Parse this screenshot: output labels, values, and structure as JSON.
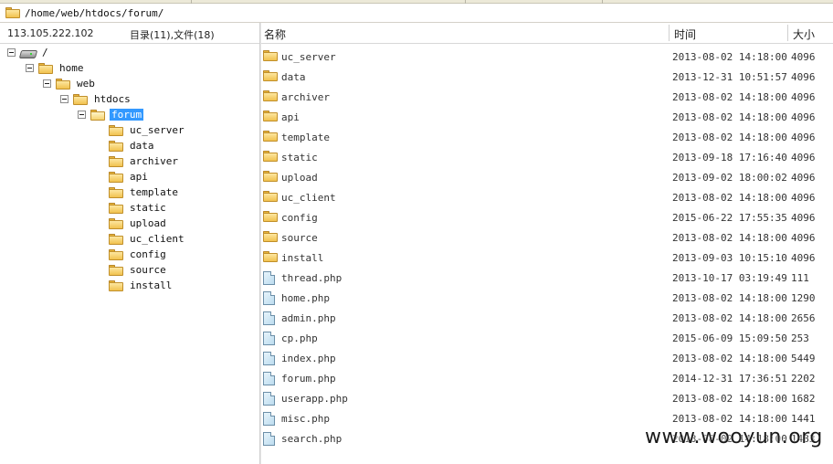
{
  "address": {
    "path": "/home/web/htdocs/forum/"
  },
  "left_header": {
    "ip": "113.105.222.102",
    "counts": "目录(11),文件(18)"
  },
  "columns": {
    "name": "名称",
    "time": "时间",
    "size": "大小"
  },
  "tree": [
    {
      "label": "/",
      "icon": "disk-icon",
      "expanded": true,
      "depth": 0
    },
    {
      "label": "home",
      "icon": "folder-icon",
      "expanded": true,
      "depth": 1
    },
    {
      "label": "web",
      "icon": "folder-icon",
      "expanded": true,
      "depth": 2
    },
    {
      "label": "htdocs",
      "icon": "folder-icon",
      "expanded": true,
      "depth": 3
    },
    {
      "label": "forum",
      "icon": "folder-open-icon",
      "expanded": true,
      "depth": 4,
      "selected": true
    },
    {
      "label": "uc_server",
      "icon": "folder-icon",
      "depth": 5
    },
    {
      "label": "data",
      "icon": "folder-icon",
      "depth": 5
    },
    {
      "label": "archiver",
      "icon": "folder-icon",
      "depth": 5
    },
    {
      "label": "api",
      "icon": "folder-icon",
      "depth": 5
    },
    {
      "label": "template",
      "icon": "folder-icon",
      "depth": 5
    },
    {
      "label": "static",
      "icon": "folder-icon",
      "depth": 5
    },
    {
      "label": "upload",
      "icon": "folder-icon",
      "depth": 5
    },
    {
      "label": "uc_client",
      "icon": "folder-icon",
      "depth": 5
    },
    {
      "label": "config",
      "icon": "folder-icon",
      "depth": 5
    },
    {
      "label": "source",
      "icon": "folder-icon",
      "depth": 5
    },
    {
      "label": "install",
      "icon": "folder-icon",
      "depth": 5
    }
  ],
  "files": [
    {
      "name": "uc_server",
      "time": "2013-08-02 14:18:00",
      "size": "4096",
      "icon": "folder-icon"
    },
    {
      "name": "data",
      "time": "2013-12-31 10:51:57",
      "size": "4096",
      "icon": "folder-icon"
    },
    {
      "name": "archiver",
      "time": "2013-08-02 14:18:00",
      "size": "4096",
      "icon": "folder-icon"
    },
    {
      "name": "api",
      "time": "2013-08-02 14:18:00",
      "size": "4096",
      "icon": "folder-icon"
    },
    {
      "name": "template",
      "time": "2013-08-02 14:18:00",
      "size": "4096",
      "icon": "folder-icon"
    },
    {
      "name": "static",
      "time": "2013-09-18 17:16:40",
      "size": "4096",
      "icon": "folder-icon"
    },
    {
      "name": "upload",
      "time": "2013-09-02 18:00:02",
      "size": "4096",
      "icon": "folder-icon"
    },
    {
      "name": "uc_client",
      "time": "2013-08-02 14:18:00",
      "size": "4096",
      "icon": "folder-icon"
    },
    {
      "name": "config",
      "time": "2015-06-22 17:55:35",
      "size": "4096",
      "icon": "folder-icon"
    },
    {
      "name": "source",
      "time": "2013-08-02 14:18:00",
      "size": "4096",
      "icon": "folder-icon"
    },
    {
      "name": "install",
      "time": "2013-09-03 10:15:10",
      "size": "4096",
      "icon": "folder-icon"
    },
    {
      "name": "thread.php",
      "time": "2013-10-17 03:19:49",
      "size": "111",
      "icon": "file-icon"
    },
    {
      "name": "home.php",
      "time": "2013-08-02 14:18:00",
      "size": "1290",
      "icon": "file-icon"
    },
    {
      "name": "admin.php",
      "time": "2013-08-02 14:18:00",
      "size": "2656",
      "icon": "file-icon"
    },
    {
      "name": "cp.php",
      "time": "2015-06-09 15:09:50",
      "size": "253",
      "icon": "file-icon"
    },
    {
      "name": "index.php",
      "time": "2013-08-02 14:18:00",
      "size": "5449",
      "icon": "file-icon"
    },
    {
      "name": "forum.php",
      "time": "2014-12-31 17:36:51",
      "size": "2202",
      "icon": "file-icon"
    },
    {
      "name": "userapp.php",
      "time": "2013-08-02 14:18:00",
      "size": "1682",
      "icon": "file-icon"
    },
    {
      "name": "misc.php",
      "time": "2013-08-02 14:18:00",
      "size": "1441",
      "icon": "file-icon"
    },
    {
      "name": "search.php",
      "time": "2013-08-02 14:18:00",
      "size": "1483",
      "icon": "file-icon"
    }
  ],
  "watermark": "www.wooyun.org"
}
